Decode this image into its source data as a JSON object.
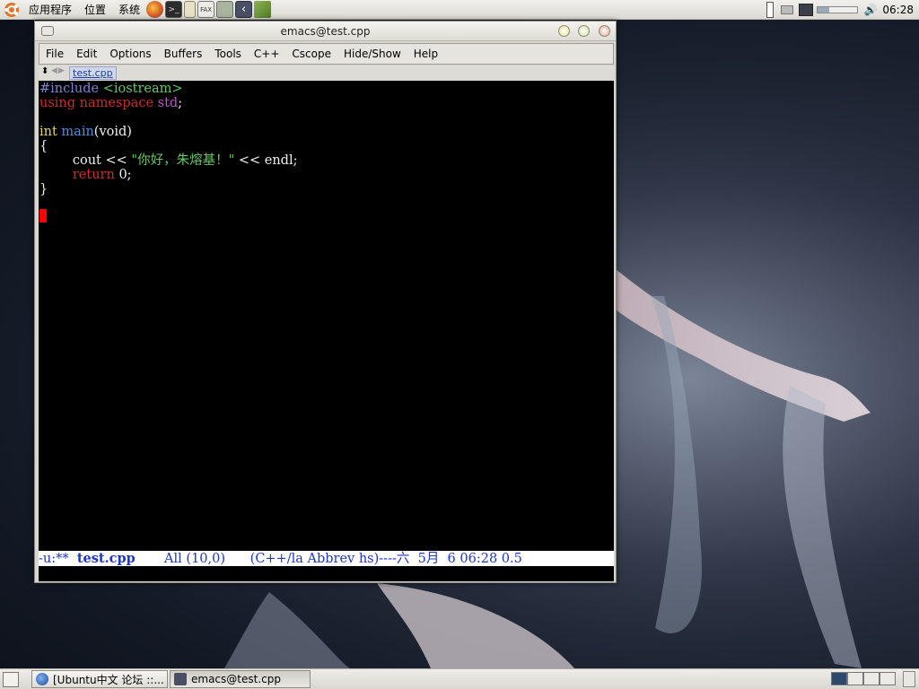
{
  "top_panel": {
    "menus": [
      "应用程序",
      "位置",
      "系统"
    ],
    "launchers": [
      "firefox-icon",
      "terminal-icon",
      "notes-icon",
      "fax-icon",
      "settings-icon",
      "emacs-icon",
      "books-icon"
    ],
    "clock": "06:28"
  },
  "window": {
    "title": "emacs@test.cpp",
    "menu": [
      "File",
      "Edit",
      "Options",
      "Buffers",
      "Tools",
      "C++",
      "Cscope",
      "Hide/Show",
      "Help"
    ],
    "tab": "test.cpp",
    "code": {
      "l1a": "#include ",
      "l1b": "<iostream>",
      "l2a": "using namespace ",
      "l2b": "std",
      "l2c": ";",
      "l4a": "int ",
      "l4b": "main",
      "l4c": "(void)",
      "l5": "{",
      "l6a": "        cout << ",
      "l6b": "\"你好，朱熔基！\"",
      "l6c": " << endl;",
      "l7a": "        return ",
      "l7b": "0;",
      "l8": "}"
    },
    "modeline": {
      "status": "-u:**  ",
      "buffer": "test.cpp",
      "rest": "       All (10,0)      (C++/la Abbrev hs)----六  5月  6 06:28 0.5"
    }
  },
  "taskbar": {
    "items": [
      "[Ubuntu中文 论坛 ::...",
      "emacs@test.cpp"
    ]
  },
  "colors": {
    "accent_cursor": "#ff0000",
    "modeline_text": "#1f36c8"
  }
}
